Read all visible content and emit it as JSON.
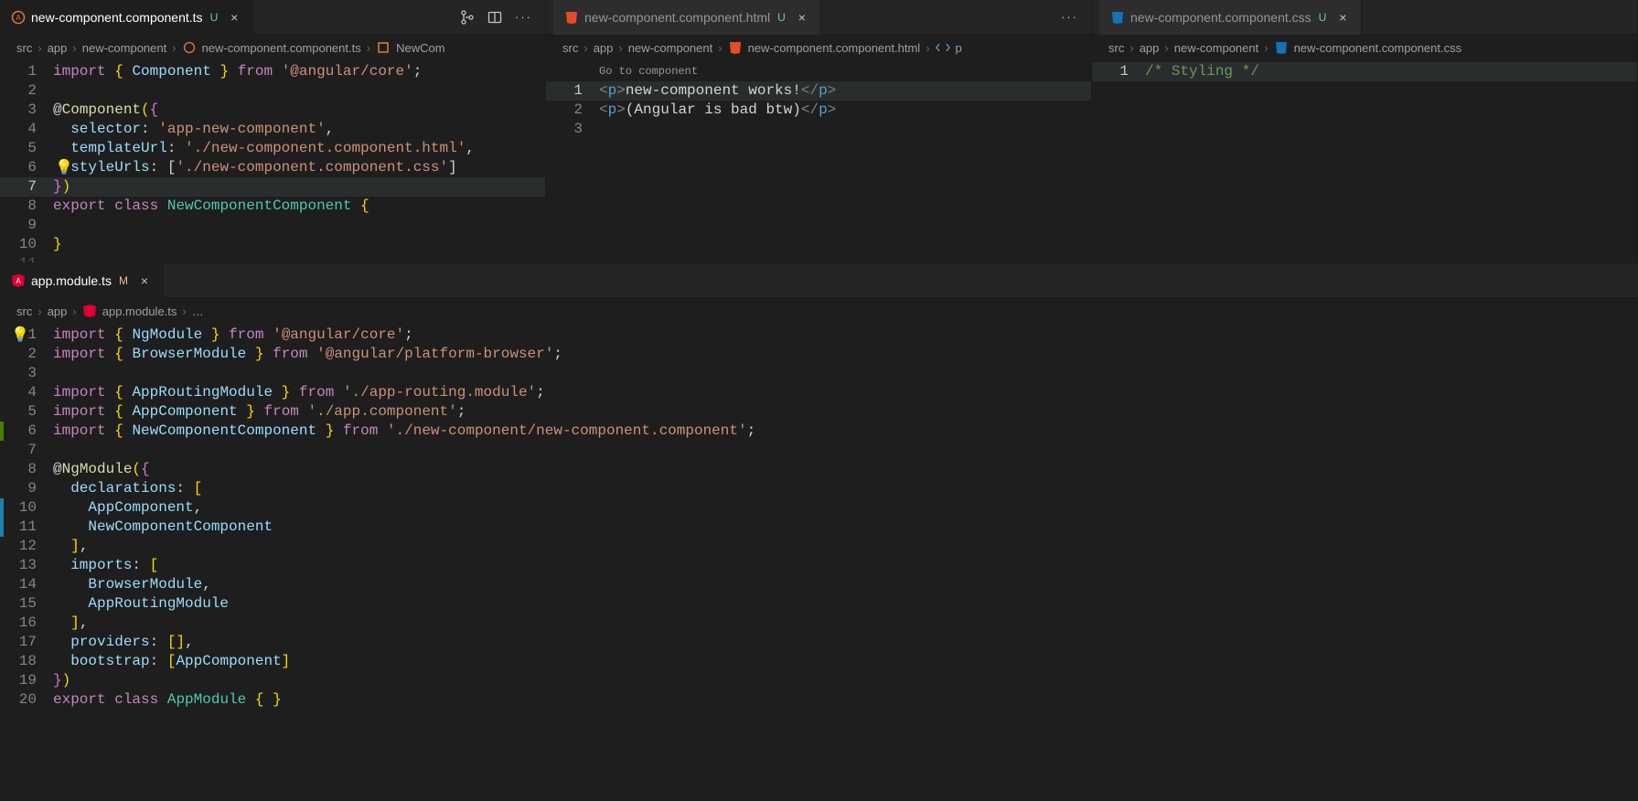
{
  "pane1": {
    "tab": {
      "file": "new-component.component.ts",
      "status": "U",
      "active": true
    },
    "actions": [
      "source-control",
      "split-editor",
      "more"
    ],
    "crumbs": [
      "src",
      "app",
      "new-component",
      "new-component.component.ts",
      "NewCom"
    ],
    "code": {
      "1": "import { Component } from '@angular/core';",
      "2": "",
      "3": "@Component({",
      "4": "  selector: 'app-new-component',",
      "5": "  templateUrl: './new-component.component.html',",
      "6": "  styleUrls: ['./new-component.component.css']",
      "7": "})",
      "8": "export class NewComponentComponent {",
      "9": "",
      "10": "}"
    }
  },
  "pane2": {
    "tab": {
      "file": "new-component.component.html",
      "status": "U",
      "active": false
    },
    "actions": [
      "more"
    ],
    "crumbs": [
      "src",
      "app",
      "new-component",
      "new-component.component.html",
      "p"
    ],
    "codelens": "Go to component",
    "code": {
      "1": "<p>new-component works!</p>",
      "2": "<p>(Angular is bad btw)</p>",
      "3": ""
    }
  },
  "pane3": {
    "tab": {
      "file": "new-component.component.css",
      "status": "U",
      "active": false
    },
    "crumbs": [
      "src",
      "app",
      "new-component",
      "new-component.component.css"
    ],
    "code": {
      "1": "/* Styling */"
    }
  },
  "pane4": {
    "tab": {
      "file": "app.module.ts",
      "status": "M",
      "active": true
    },
    "crumbs": [
      "src",
      "app",
      "app.module.ts",
      "…"
    ],
    "code": {
      "1": "import { NgModule } from '@angular/core';",
      "2": "import { BrowserModule } from '@angular/platform-browser';",
      "3": "",
      "4": "import { AppRoutingModule } from './app-routing.module';",
      "5": "import { AppComponent } from './app.component';",
      "6": "import { NewComponentComponent } from './new-component/new-component.component';",
      "7": "",
      "8": "@NgModule({",
      "9": "  declarations: [",
      "10": "    AppComponent,",
      "11": "    NewComponentComponent",
      "12": "  ],",
      "13": "  imports: [",
      "14": "    BrowserModule,",
      "15": "    AppRoutingModule",
      "16": "  ],",
      "17": "  providers: [],",
      "18": "  bootstrap: [AppComponent]",
      "19": "})",
      "20": "export class AppModule { }"
    }
  }
}
